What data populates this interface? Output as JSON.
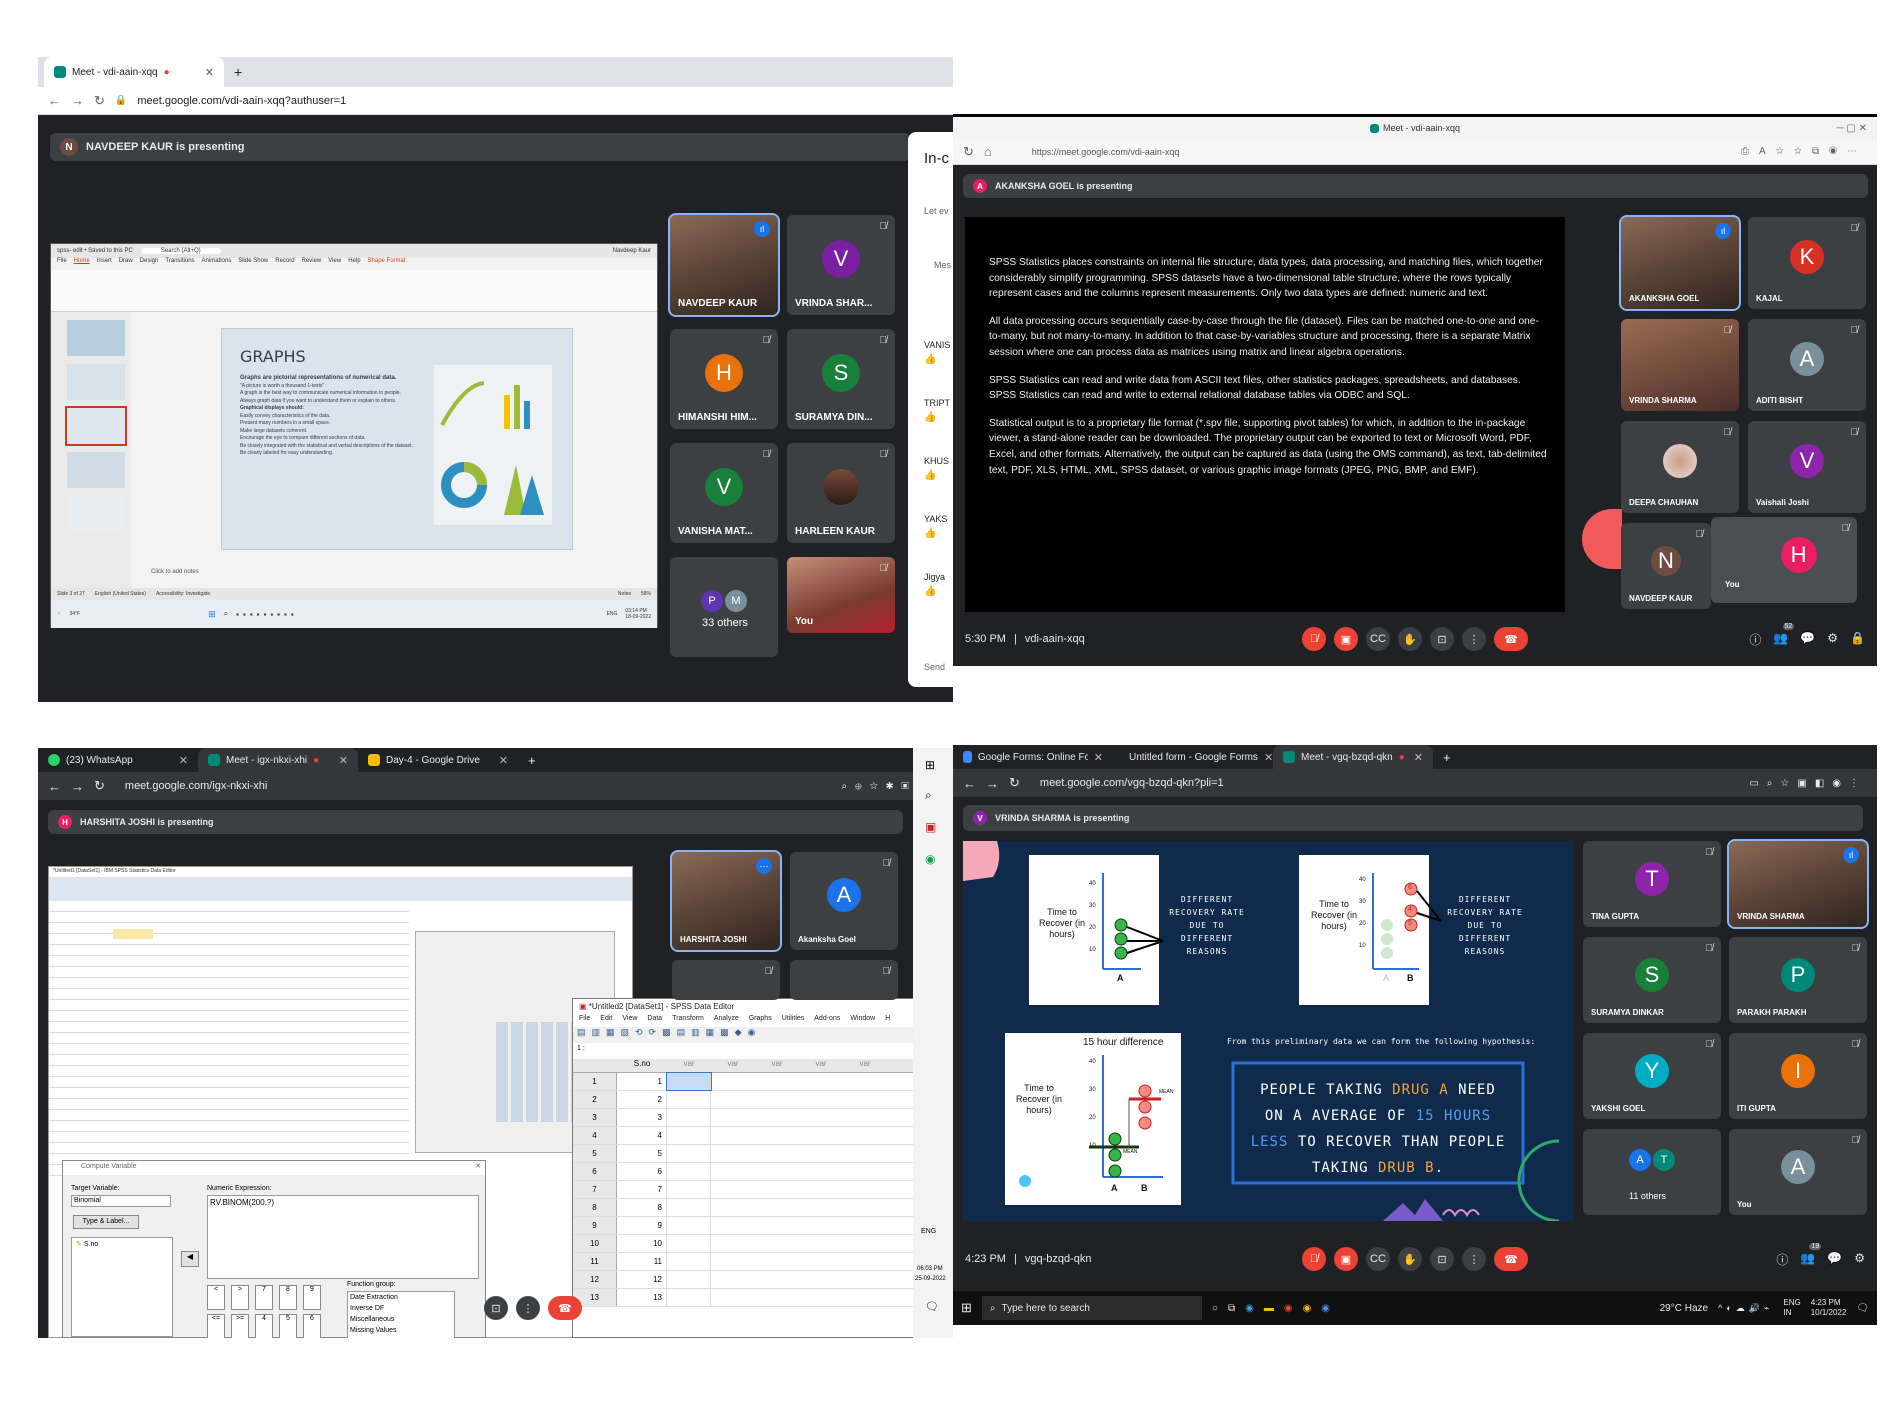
{
  "q1": {
    "tab_title": "Meet - vdi-aain-xqq",
    "url": "meet.google.com/vdi-aain-xqq?authuser=1",
    "presenting": "NAVDEEP KAUR is presenting",
    "presenter_initial": "N",
    "slide": {
      "app_title": "spss- edit • Saved to this PC",
      "search": "Search (Alt+Q)",
      "user": "Navdeep Kaur",
      "ribbon_tabs": [
        "File",
        "Home",
        "Insert",
        "Draw",
        "Design",
        "Transitions",
        "Animations",
        "Slide Show",
        "Record",
        "Review",
        "View",
        "Help",
        "Shape Format"
      ],
      "title": "GRAPHS",
      "bullets": [
        "Graphs are pictorial representations of numerical data.",
        "\"A picture is worth a thousand 1-texts\"",
        "A graph is the best way to communicate numerical information to people.",
        "Always graph data if you want to understand them or explain to others.",
        "Graphical displays should:",
        "Easily convey characteristics of the data.",
        "Present many numbers in a small space.",
        "Make large datasets coherent.",
        "Encourage the eye to compare different sections of data.",
        "Be closely integrated with the statistical and verbal descriptions of the dataset.",
        "Be clearly labeled for easy understanding."
      ],
      "notes": "Click to add notes",
      "status": "Slide 3 of 27",
      "language": "English (United States)",
      "accessibility": "Accessibility: Investigate",
      "notes_btn": "Notes",
      "zoom": "58%",
      "temp": "34°F",
      "clock_time": "03:14 PM",
      "clock_date": "18-09-2022",
      "lang_short": "ENG"
    },
    "participants": [
      {
        "name": "NAVDEEP KAUR",
        "initial": "",
        "color": ""
      },
      {
        "name": "VRINDA SHAR...",
        "initial": "V",
        "color": "#7b1fa2"
      },
      {
        "name": "HIMANSHI HIM...",
        "initial": "H",
        "color": "#e8710a"
      },
      {
        "name": "SURAMYA DIN...",
        "initial": "S",
        "color": "#188038"
      },
      {
        "name": "VANISHA MAT...",
        "initial": "V",
        "color": "#188038"
      },
      {
        "name": "HARLEEN KAUR",
        "initial": "",
        "color": ""
      },
      {
        "name": "33 others",
        "initial": "P",
        "initial2": "M",
        "color": "#5e35b1",
        "color2": "#78909c"
      },
      {
        "name": "You",
        "initial": "",
        "color": ""
      }
    ],
    "chat": {
      "heading": "In-c",
      "hint": "Let ev",
      "label": "Mes",
      "names": [
        "VANIS",
        "TRIPT",
        "KHUS",
        "YAKS",
        "Jigya"
      ],
      "send": "Send"
    }
  },
  "q2": {
    "window_title": "Meet - vdi-aain-xqq",
    "url": "https://meet.google.com/vdi-aain-xqq",
    "presenting": "AKANKSHA GOEL is presenting",
    "presenter_initial": "A",
    "paragraphs": [
      "SPSS Statistics places constraints on internal file structure, data types, data processing, and matching files, which together considerably simplify programming. SPSS datasets have a two-dimensional table structure, where the rows typically represent cases and the columns represent measurements. Only two data types are defined: numeric and text.",
      "All data processing occurs sequentially case-by-case through the file (dataset). Files can be matched one-to-one and one-to-many, but not many-to-many. In addition to that case-by-variables structure and processing, there is a separate Matrix session where one can process data as matrices using matrix and linear algebra operations.",
      "SPSS Statistics can read and write data from ASCII text files, other statistics packages, spreadsheets, and databases. SPSS Statistics can read and write to external relational database tables via ODBC and SQL.",
      "Statistical output is to a proprietary file format (*.spv file, supporting pivot tables) for which, in addition to the in-package viewer, a stand-alone reader can be downloaded. The proprietary output can be exported to text or Microsoft Word, PDF, Excel, and other formats. Alternatively, the output can be captured as data (using the OMS command), as text, tab-delimited text, PDF, XLS, HTML, XML, SPSS dataset, or various graphic image formats (JPEG, PNG, BMP, and EMF)."
    ],
    "participants": [
      {
        "name": "AKANKSHA GOEL",
        "initial": "",
        "color": ""
      },
      {
        "name": "KAJAL",
        "initial": "K",
        "color": "#d93025"
      },
      {
        "name": "VRINDA SHARMA",
        "initial": "",
        "color": ""
      },
      {
        "name": "ADITI BISHT",
        "initial": "A",
        "color": "#78909c"
      },
      {
        "name": "DEEPA CHAUHAN",
        "initial": "",
        "color": ""
      },
      {
        "name": "Vaishali Joshi",
        "initial": "V",
        "color": "#8e24aa"
      },
      {
        "name": "NAVDEEP KAUR",
        "initial": "N",
        "color": "#6d4c41"
      },
      {
        "name": "You",
        "initial": "H",
        "color": "#e91e63"
      }
    ],
    "time": "5:30 PM",
    "code": "vdi-aain-xqq",
    "people_count": "52"
  },
  "q3": {
    "tabs": [
      "(23) WhatsApp",
      "Meet - igx-nkxi-xhi",
      "Day-4 - Google Drive"
    ],
    "url": "meet.google.com/igx-nkxi-xhi",
    "presenting": "HARSHITA JOSHI is presenting",
    "presenter_initial": "H",
    "spss_bg_title": "*Untitled1 [DataSet1] - IBM SPSS Statistics Data Editor",
    "participants": [
      {
        "name": "HARSHITA JOSHI",
        "initial": "",
        "color": ""
      },
      {
        "name": "Akanksha Goel",
        "initial": "A",
        "color": "#1a73e8"
      }
    ],
    "compute": {
      "title": "Compute Variable",
      "target_label": "Target Variable:",
      "target_value": "Binomial",
      "numeric_label": "Numeric Expression:",
      "expression": "RV.BINOM(200,?)",
      "type_label": "Type & Label...",
      "var": "S.no",
      "function_group": "Function group:",
      "functions": [
        "Date Extraction",
        "Inverse DF",
        "Miscellaneous",
        "Missing Values"
      ],
      "keypad": [
        "<",
        ">",
        "7",
        "8",
        "9",
        "<=",
        ">=",
        "4",
        "5",
        "6"
      ]
    },
    "editor": {
      "title": "*Untitled2 [DataSet1] - SPSS Data Editor",
      "menu": [
        "File",
        "Edit",
        "View",
        "Data",
        "Transform",
        "Analyze",
        "Graphs",
        "Utilities",
        "Add-ons",
        "Window",
        "H"
      ],
      "cell_ref": "1 :",
      "col_header": "S.no",
      "var_cols": [
        "var",
        "var",
        "var",
        "var",
        "var"
      ],
      "rows": [
        "1",
        "2",
        "3",
        "4",
        "5",
        "6",
        "7",
        "8",
        "9",
        "10",
        "11",
        "12",
        "13"
      ]
    },
    "clock_time": "06:03 PM",
    "clock_date": "25-09-2022",
    "lang": "ENG"
  },
  "q4": {
    "tabs": [
      "Google Forms: Online Form Crea",
      "Untitled form - Google Forms",
      "Meet - vgq-bzqd-qkn"
    ],
    "url": "meet.google.com/vgq-bzqd-qkn?pli=1",
    "presenting": "VRINDA SHARMA is presenting",
    "presenter_initial": "V",
    "slide": {
      "graph_a_ylabel": "Time to Recover (in hours)",
      "graph_a_x": "A",
      "graph_b_x": [
        "A",
        "B"
      ],
      "yticks": [
        "40",
        "30",
        "20",
        "10"
      ],
      "rate_text": "DIFFERENT RECOVERY RATE DUE TO DIFFERENT REASONS",
      "graph_c_title": "15 hour difference",
      "mean": "MEAN",
      "hypothesis_intro": "From this preliminary data we can form the following hypothesis:",
      "hypothesis": [
        "PEOPLE TAKING ",
        "DRUG A",
        " NEED ON A AVERAGE OF ",
        "15 HOURS LESS",
        " TO RECOVER THAN PEOPLE TAKING ",
        "DRUB B",
        "."
      ],
      "b_circles": [
        "6",
        "4",
        "5"
      ]
    },
    "participants": [
      {
        "name": "TINA GUPTA",
        "initial": "T",
        "color": "#8e24aa"
      },
      {
        "name": "VRINDA SHARMA",
        "initial": "",
        "color": ""
      },
      {
        "name": "SURAMYA DINKAR",
        "initial": "S",
        "color": "#188038"
      },
      {
        "name": "PARAKH PARAKH",
        "initial": "P",
        "color": "#00897b"
      },
      {
        "name": "YAKSHI GOEL",
        "initial": "Y",
        "color": "#00acc1"
      },
      {
        "name": "ITI GUPTA",
        "initial": "I",
        "color": "#e8710a"
      },
      {
        "name": "11 others",
        "initial": "A",
        "initial2": "T",
        "color": "#1a73e8",
        "color2": "#00897b"
      },
      {
        "name": "You",
        "initial": "A",
        "color": "#78909c"
      }
    ],
    "time": "4:23 PM",
    "code": "vgq-bzqd-qkn",
    "people_count": "19",
    "taskbar": {
      "search": "Type here to search",
      "weather": "29°C  Haze",
      "lang": "ENG",
      "region": "IN",
      "time": "4:23 PM",
      "date": "10/1/2022"
    }
  },
  "colors": {
    "meet_dark": "#202124",
    "tile": "#3c4043",
    "end_call": "#ea4335",
    "slide_navy": "#0f2a4a",
    "drug_orange": "#f4a340"
  }
}
